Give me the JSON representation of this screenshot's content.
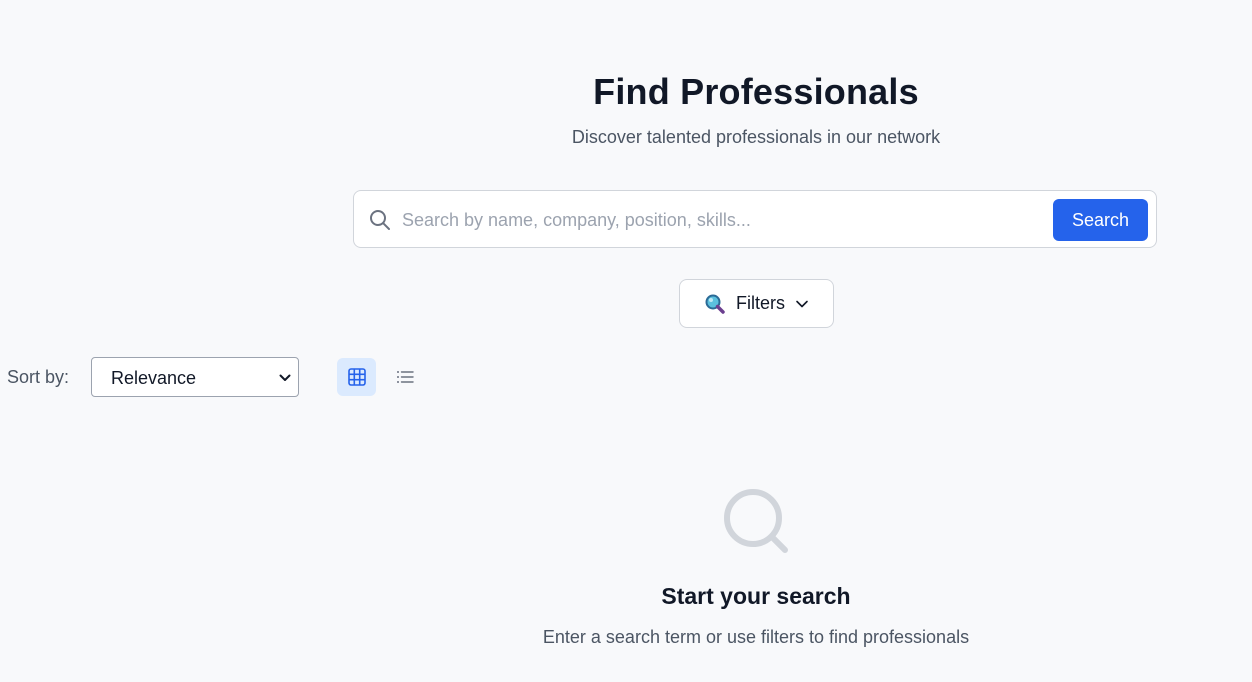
{
  "header": {
    "title": "Find Professionals",
    "subtitle": "Discover talented professionals in our network"
  },
  "search": {
    "placeholder": "Search by name, company, position, skills...",
    "value": "",
    "button_label": "Search",
    "icon": "search-icon"
  },
  "filters": {
    "label": "Filters",
    "icon": "magnifying-glass-emoji-icon",
    "chevron": "chevron-down-icon"
  },
  "toolbar": {
    "sort_label": "Sort by:",
    "sort_value": "Relevance",
    "views": [
      {
        "name": "grid",
        "icon": "grid-icon",
        "active": true
      },
      {
        "name": "list",
        "icon": "list-icon",
        "active": false
      }
    ]
  },
  "empty_state": {
    "icon": "search-icon",
    "title": "Start your search",
    "text": "Enter a search term or use filters to find professionals"
  },
  "colors": {
    "background": "#f8f9fb",
    "accent": "#2563eb",
    "active_view_bg": "#dbeafe"
  }
}
